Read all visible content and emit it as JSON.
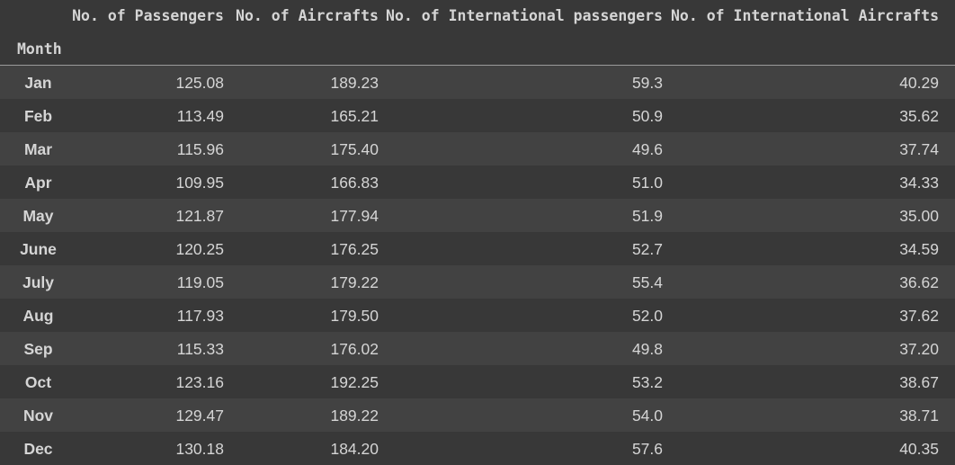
{
  "table": {
    "index_label": "Month",
    "columns": [
      "No. of Passengers",
      "No. of Aircrafts",
      "No. of International passengers",
      "No. of International Aircrafts"
    ],
    "rows": [
      {
        "month": "Jan",
        "values": [
          "125.08",
          "189.23",
          "59.3",
          "40.29"
        ]
      },
      {
        "month": "Feb",
        "values": [
          "113.49",
          "165.21",
          "50.9",
          "35.62"
        ]
      },
      {
        "month": "Mar",
        "values": [
          "115.96",
          "175.40",
          "49.6",
          "37.74"
        ]
      },
      {
        "month": "Apr",
        "values": [
          "109.95",
          "166.83",
          "51.0",
          "34.33"
        ]
      },
      {
        "month": "May",
        "values": [
          "121.87",
          "177.94",
          "51.9",
          "35.00"
        ]
      },
      {
        "month": "June",
        "values": [
          "120.25",
          "176.25",
          "52.7",
          "34.59"
        ]
      },
      {
        "month": "July",
        "values": [
          "119.05",
          "179.22",
          "55.4",
          "36.62"
        ]
      },
      {
        "month": "Aug",
        "values": [
          "117.93",
          "179.50",
          "52.0",
          "37.62"
        ]
      },
      {
        "month": "Sep",
        "values": [
          "115.33",
          "176.02",
          "49.8",
          "37.20"
        ]
      },
      {
        "month": "Oct",
        "values": [
          "123.16",
          "192.25",
          "53.2",
          "38.67"
        ]
      },
      {
        "month": "Nov",
        "values": [
          "129.47",
          "189.22",
          "54.0",
          "38.71"
        ]
      },
      {
        "month": "Dec",
        "values": [
          "130.18",
          "184.20",
          "57.6",
          "40.35"
        ]
      }
    ]
  },
  "colors": {
    "background": "#383838",
    "row_alt": "#424242",
    "text": "#d5d5d5",
    "border": "#9a9a9a"
  }
}
